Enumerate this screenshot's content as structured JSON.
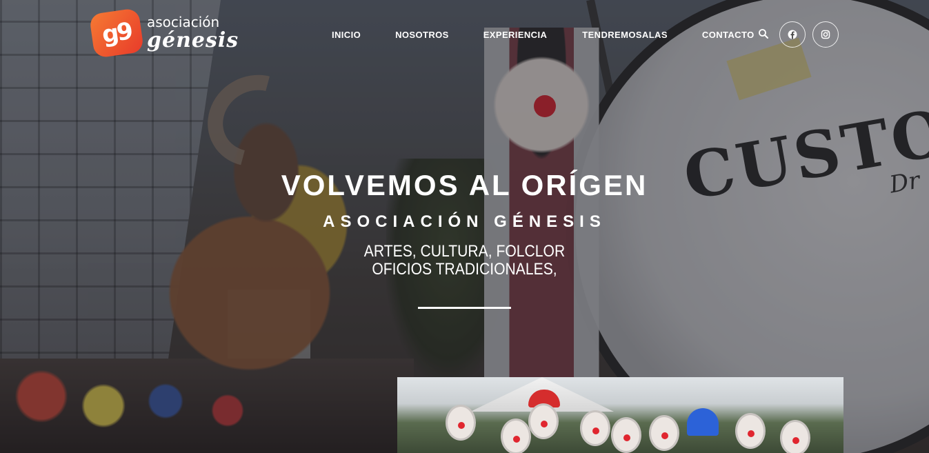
{
  "logo": {
    "mark": "g9",
    "line1": "asociación",
    "line2": "génesis"
  },
  "nav": {
    "items": [
      {
        "label": "INICIO"
      },
      {
        "label": "NOSOTROS"
      },
      {
        "label": "EXPERIENCIA"
      },
      {
        "label": "TENDREMOSALAS"
      },
      {
        "label": "CONTACTO"
      }
    ]
  },
  "icons": {
    "search": "search-icon",
    "facebook": "facebook-icon",
    "instagram": "instagram-icon"
  },
  "hero": {
    "title": "VOLVEMOS AL ORÍGEN",
    "subtitle": "ASOCIACIÓN GÉNESIS",
    "desc_line1": "ARTES, CULTURA, FOLCLOR",
    "desc_line2": "OFICIOS TRADICIONALES,"
  },
  "background_drum_text": {
    "main": "CUSTO",
    "sub": "Dr"
  },
  "colors": {
    "logo_gradient_start": "#f57a33",
    "logo_gradient_end": "#e83b2a",
    "text": "#ffffff"
  }
}
